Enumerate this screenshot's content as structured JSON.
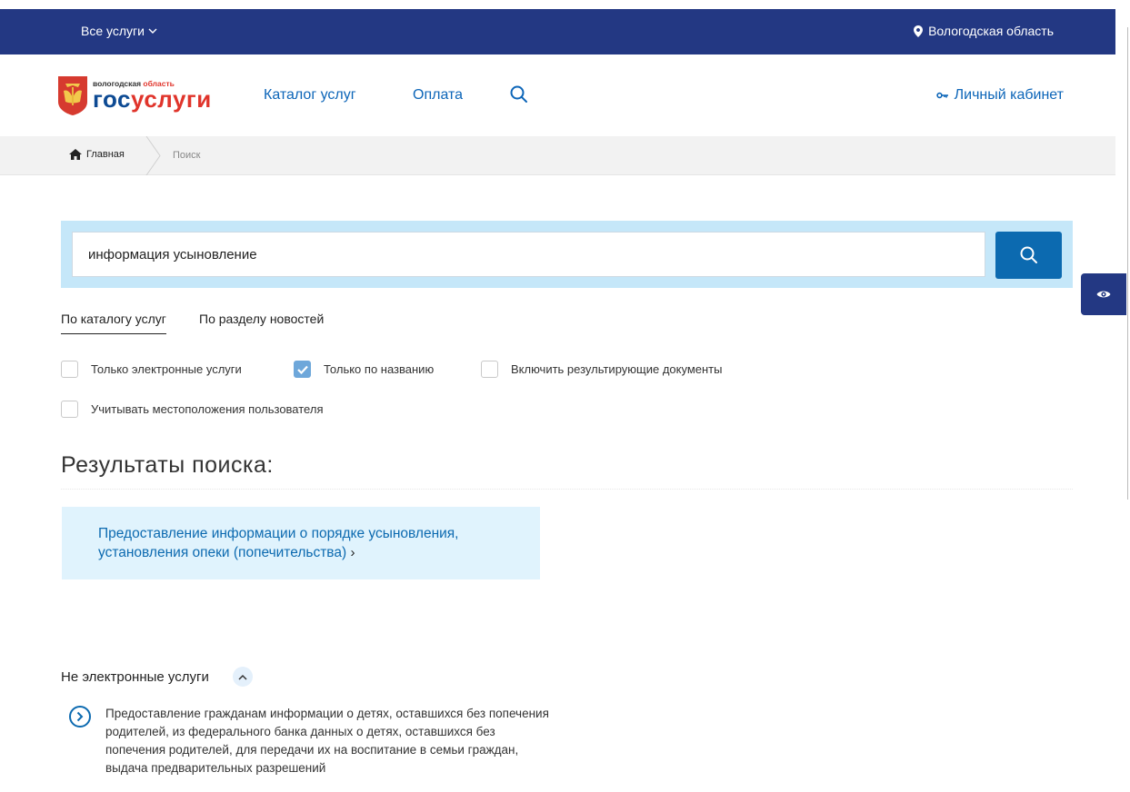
{
  "topbar": {
    "all_services": "Все услуги",
    "region": "Вологодская область"
  },
  "logo": {
    "region_prefix": "вологодская",
    "region_suffix": "область",
    "brand_part1": "гос",
    "brand_part2": "услуги"
  },
  "nav": {
    "catalog": "Каталог услуг",
    "payment": "Оплата",
    "cabinet": "Личный кабинет"
  },
  "breadcrumb": {
    "home": "Главная",
    "current": "Поиск"
  },
  "search": {
    "value": "информация усыновление"
  },
  "tabs": {
    "catalog": "По каталогу услуг",
    "news": "По разделу новостей"
  },
  "filters": [
    {
      "label": "Только электронные услуги",
      "checked": false
    },
    {
      "label": "Только по названию",
      "checked": true
    },
    {
      "label": "Включить результирующие документы",
      "checked": false
    },
    {
      "label": "Учитывать местоположения пользователя",
      "checked": false
    }
  ],
  "results": {
    "title": "Результаты поиска:",
    "top_result_line1": "Предоставление информации о порядке усыновления,",
    "top_result_line2": "установления опеки (попечительства)",
    "top_result_arrow": "›"
  },
  "non_electronic": {
    "heading": "Не электронные услуги",
    "item_text": "Предоставление гражданам информации о детях, оставшихся без попечения родителей, из федерального банка данных о детях, оставшихся без попечения родителей, для передачи их на воспитание в семьи граждан, выдача предварительных разрешений"
  },
  "colors": {
    "topbar": "#233883",
    "link": "#0c65b8",
    "search_panel": "#c5e7f9",
    "search_button": "#0c6ab0",
    "result_card": "#e0f3fd",
    "brand_red": "#e0342b"
  }
}
